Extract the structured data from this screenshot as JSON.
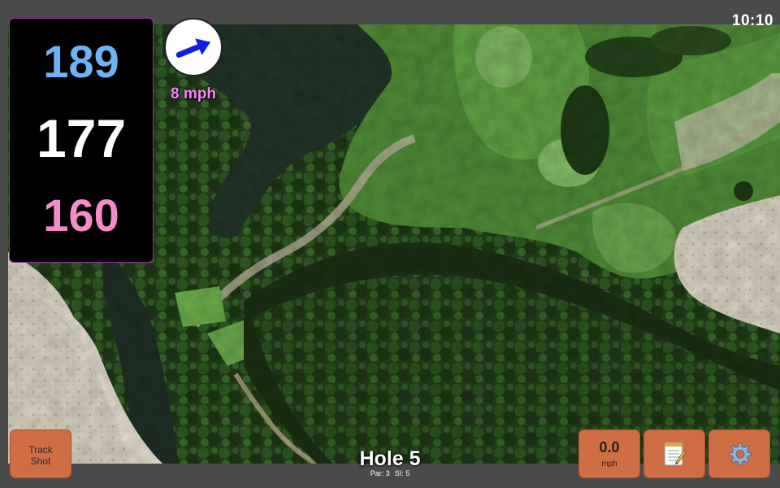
{
  "status": {
    "time": "10:10"
  },
  "distances": {
    "back": {
      "value": "189",
      "color": "#6cb4f5"
    },
    "middle": {
      "value": "177",
      "color": "#ffffff"
    },
    "front": {
      "value": "160",
      "color": "#f58cc9"
    }
  },
  "wind": {
    "speed": "8 mph",
    "arrow_color": "#1020e0",
    "icon": "wind-direction-arrow"
  },
  "hole": {
    "title": "Hole 5",
    "par": "Par: 3",
    "si": "SI: 5"
  },
  "buttons": {
    "track_shot": {
      "line1": "Track",
      "line2": "Shot"
    },
    "speed": {
      "value": "0.0",
      "unit": "mph"
    },
    "notes": {
      "icon": "notepad-icon"
    },
    "settings": {
      "icon": "gear-icon"
    }
  },
  "theme": {
    "button_color": "#d06e43",
    "panel_border": "#9b2f9b"
  }
}
